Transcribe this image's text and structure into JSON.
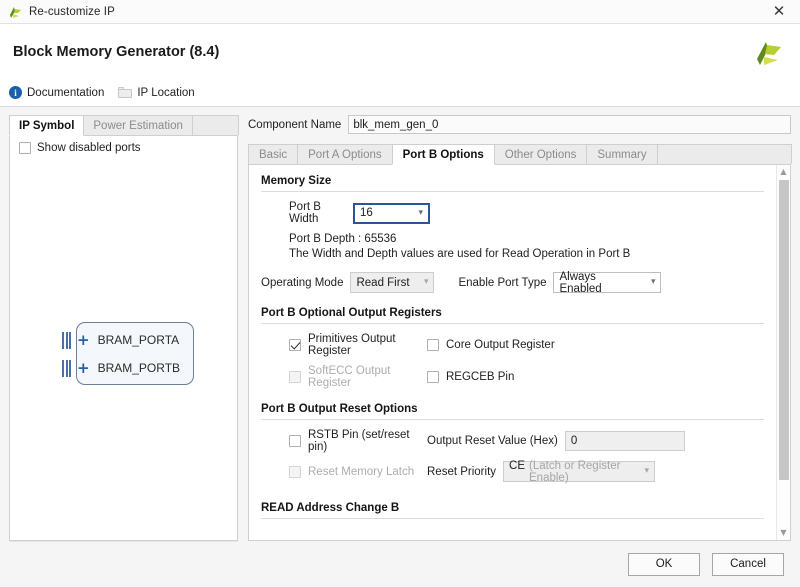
{
  "titlebar": {
    "title": "Re-customize IP",
    "close_label": "✕",
    "icon": "xilinx-logo-icon"
  },
  "header": {
    "title": "Block Memory Generator (8.4)",
    "logo": "xilinx-logo"
  },
  "links": [
    {
      "label": "Documentation",
      "icon": "info-icon"
    },
    {
      "label": "IP Location",
      "icon": "folder-icon"
    }
  ],
  "left_panel": {
    "tabs": [
      {
        "label": "IP Symbol",
        "active": true
      },
      {
        "label": "Power Estimation",
        "active": false
      }
    ],
    "show_disabled_ports": {
      "label": "Show disabled ports",
      "checked": false
    },
    "symbol": {
      "ports": [
        {
          "label": "BRAM_PORTA",
          "expander": "+"
        },
        {
          "label": "BRAM_PORTB",
          "expander": "+"
        }
      ]
    }
  },
  "component_name": {
    "label": "Component Name",
    "value": "blk_mem_gen_0"
  },
  "main_tabs": [
    {
      "label": "Basic",
      "active": false
    },
    {
      "label": "Port A Options",
      "active": false
    },
    {
      "label": "Port B Options",
      "active": true
    },
    {
      "label": "Other Options",
      "active": false
    },
    {
      "label": "Summary",
      "active": false
    }
  ],
  "memory_size": {
    "section_title": "Memory Size",
    "port_b_width_label": "Port B Width",
    "port_b_width_value": "16",
    "port_b_depth": "Port B Depth : 65536",
    "note": "The Width and Depth values are used for Read Operation in Port B",
    "operating_mode_label": "Operating Mode",
    "operating_mode_value": "Read First",
    "enable_port_type_label": "Enable Port Type",
    "enable_port_type_value": "Always Enabled"
  },
  "optional_output_registers": {
    "section_title": "Port B Optional Output Registers",
    "primitives_output_register": {
      "label": "Primitives Output Register",
      "checked": true,
      "disabled": false
    },
    "core_output_register": {
      "label": "Core Output Register",
      "checked": false,
      "disabled": false
    },
    "softecc_output_register": {
      "label": "SoftECC Output Register",
      "checked": false,
      "disabled": true
    },
    "regceb_pin": {
      "label": "REGCEB Pin",
      "checked": false,
      "disabled": false
    }
  },
  "output_reset_options": {
    "section_title": "Port B Output Reset Options",
    "rstb_pin": {
      "label": "RSTB Pin (set/reset pin)",
      "checked": false,
      "disabled": false
    },
    "reset_memory_latch": {
      "label": "Reset Memory Latch",
      "checked": false,
      "disabled": true
    },
    "output_reset_value_label": "Output Reset Value (Hex)",
    "output_reset_value": "0",
    "reset_priority_label": "Reset Priority",
    "reset_priority_value": "CE",
    "reset_priority_suffix": "(Latch or Register Enable)"
  },
  "read_address_change": {
    "section_title": "READ Address Change B"
  },
  "footer": {
    "ok_label": "OK",
    "cancel_label": "Cancel"
  },
  "scrollbar": {
    "up_arrow": "▲",
    "down_arrow": "▼"
  },
  "colors": {
    "accent_blue": "#2a5699",
    "logo_green": "#b5cf2e",
    "port_blue": "#4a6fa5",
    "info_blue": "#1d5fa8"
  }
}
